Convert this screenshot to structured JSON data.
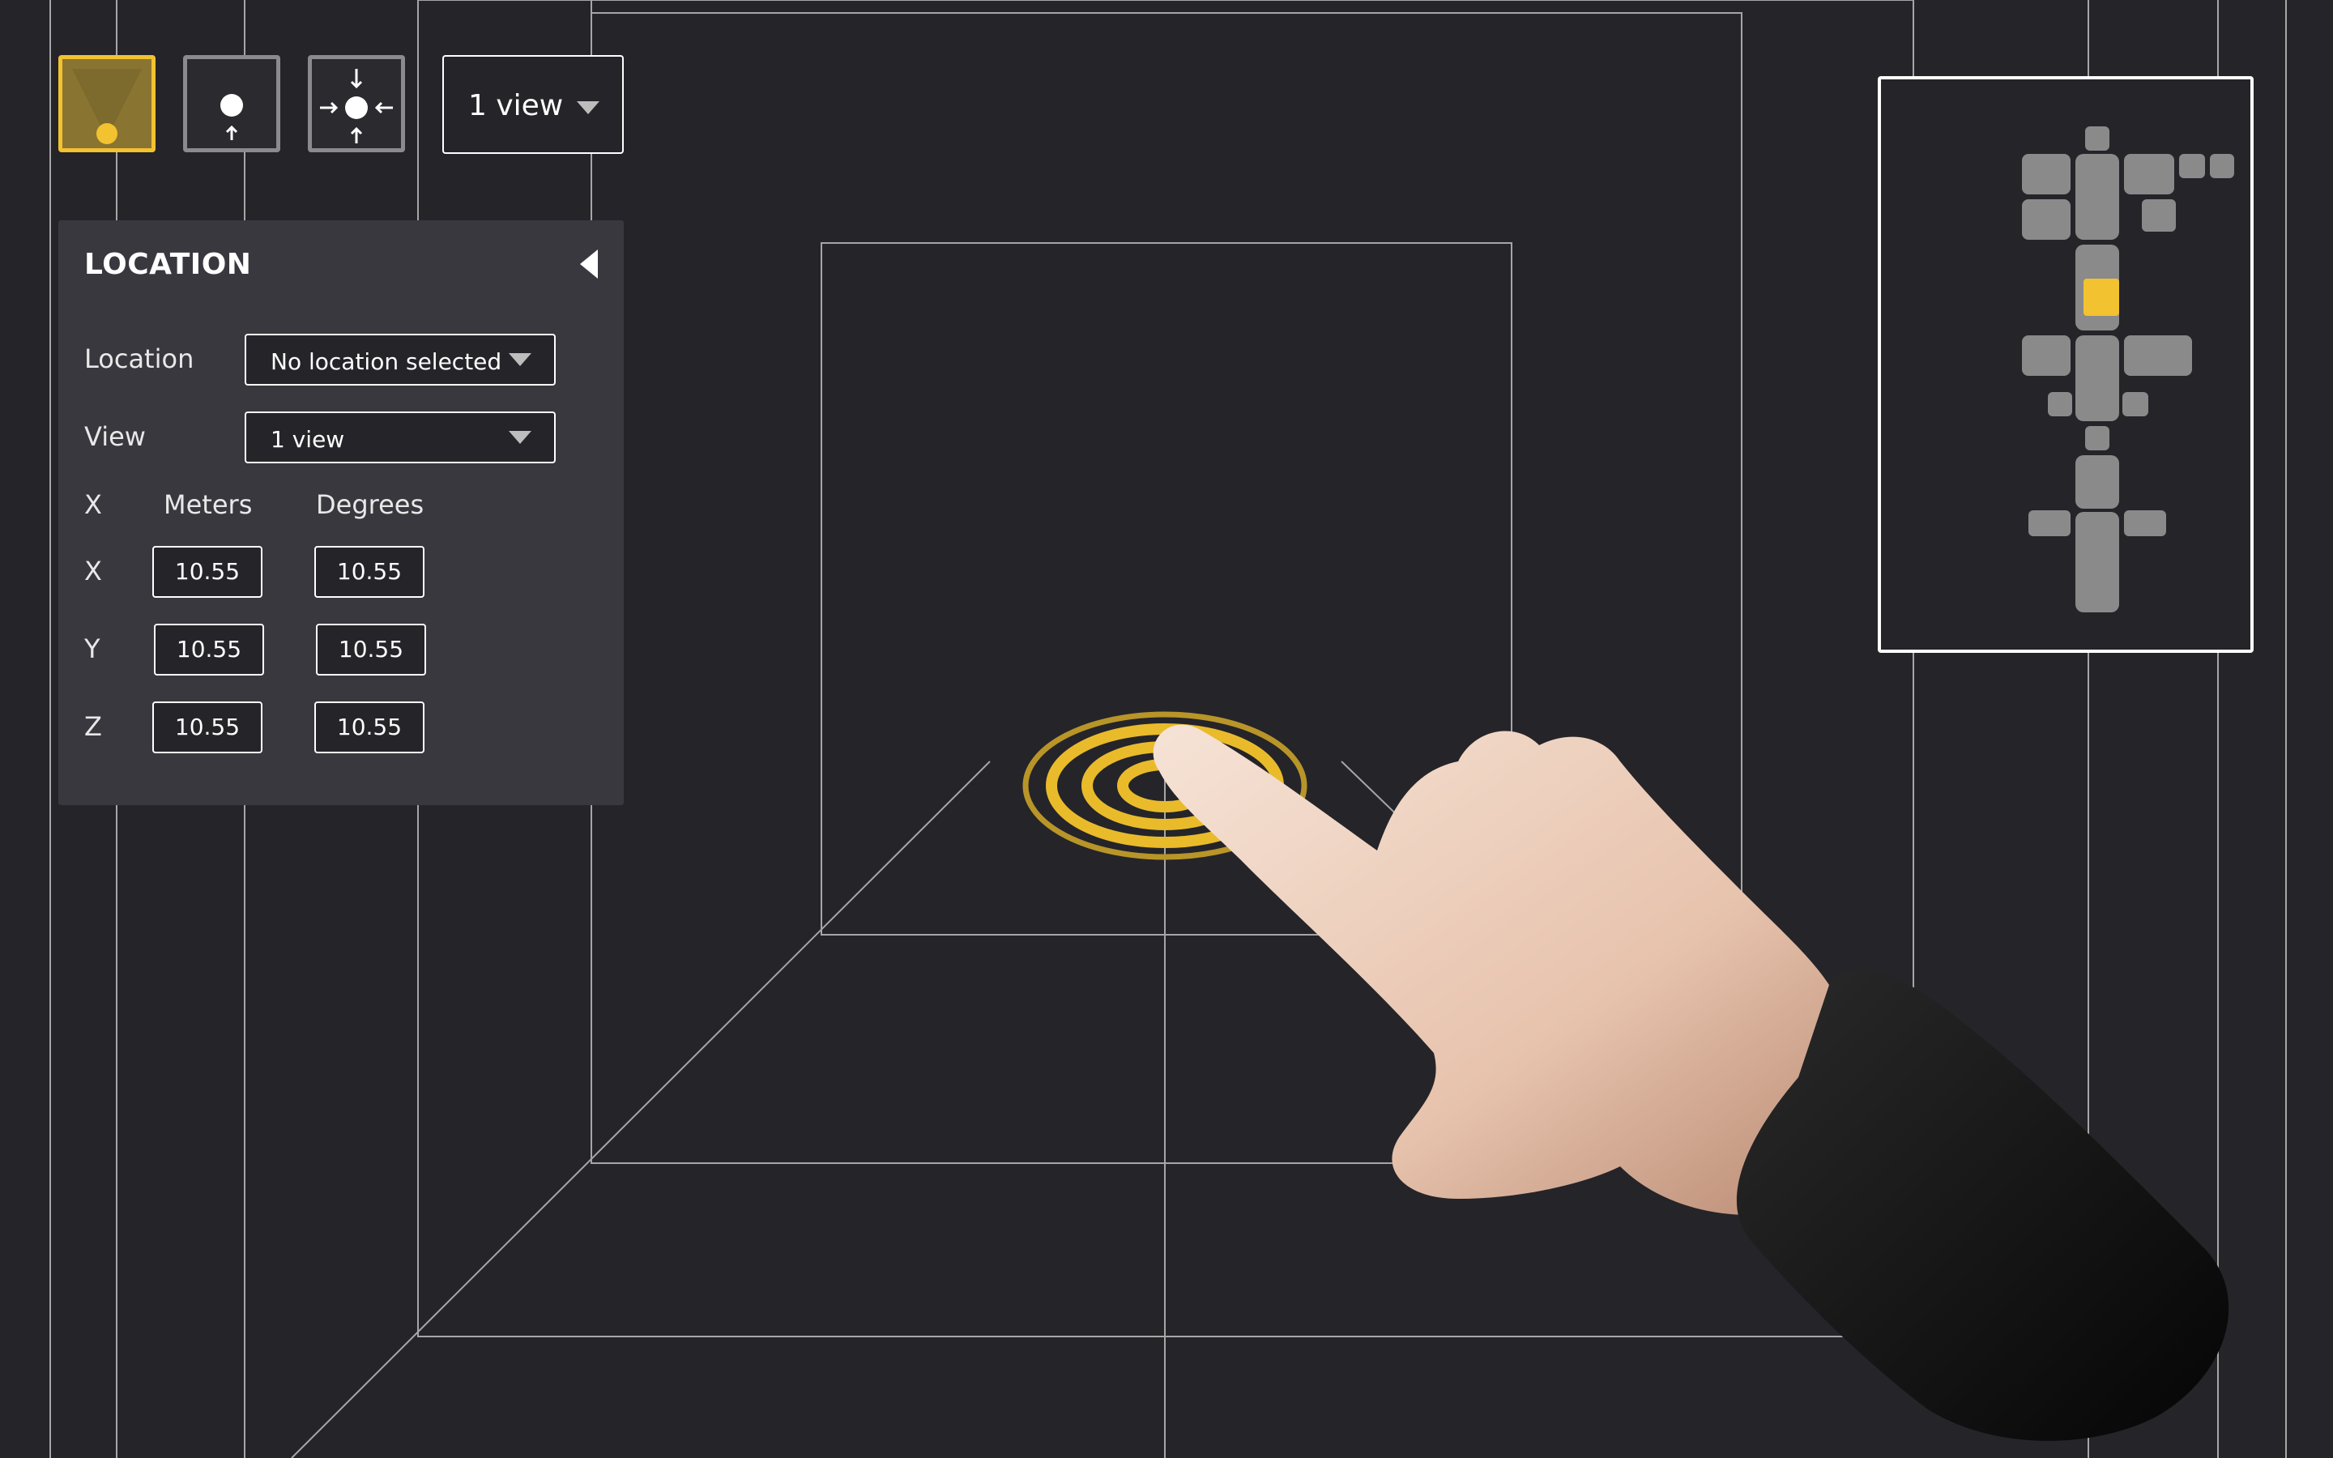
{
  "toolbar": {
    "tools": [
      {
        "name": "spotlight-tool",
        "active": true
      },
      {
        "name": "point-tool",
        "active": false
      },
      {
        "name": "focus-tool",
        "active": false
      }
    ],
    "view_select": "1 view"
  },
  "panel": {
    "title": "LOCATION",
    "location_label": "Location",
    "location_value": "No location selected",
    "view_label": "View",
    "view_value": "1 view",
    "axis_header": "X",
    "meters_header": "Meters",
    "degrees_header": "Degrees",
    "rows": [
      {
        "axis": "X",
        "meters": "10.55",
        "degrees": "10.55"
      },
      {
        "axis": "Y",
        "meters": "10.55",
        "degrees": "10.55"
      },
      {
        "axis": "Z",
        "meters": "10.55",
        "degrees": "10.55"
      }
    ]
  },
  "colors": {
    "background": "#252429",
    "panel": "#39383e",
    "accent": "#f2c230",
    "minimap_block": "#8a8a8a"
  }
}
